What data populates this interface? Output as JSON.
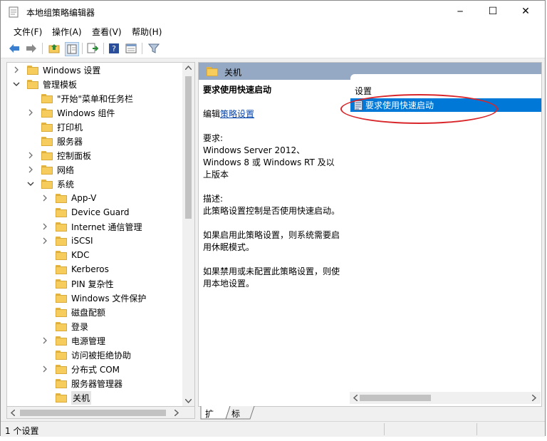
{
  "window": {
    "title": "本地组策略编辑器",
    "controls": {
      "minimize": "─",
      "maximize": "☐",
      "close": "✕"
    }
  },
  "menu": [
    "文件(F)",
    "操作(A)",
    "查看(V)",
    "帮助(H)"
  ],
  "toolbar": {
    "icons": [
      "back-arrow-icon",
      "forward-arrow-icon",
      "up-folder-icon",
      "show-hide-tree-icon",
      "export-list-icon",
      "help-icon",
      "properties-icon",
      "filter-icon"
    ]
  },
  "tree": {
    "items": [
      {
        "label": "Windows 设置",
        "expander": "collapsed"
      },
      {
        "label": "管理模板",
        "expander": "expanded"
      },
      {
        "label": "\"开始\"菜单和任务栏",
        "expander": "none"
      },
      {
        "label": "Windows 组件",
        "expander": "collapsed"
      },
      {
        "label": "打印机",
        "expander": "none"
      },
      {
        "label": "服务器",
        "expander": "none"
      },
      {
        "label": "控制面板",
        "expander": "collapsed"
      },
      {
        "label": "网络",
        "expander": "collapsed"
      },
      {
        "label": "系统",
        "expander": "expanded"
      },
      {
        "label": "App-V",
        "expander": "collapsed"
      },
      {
        "label": "Device Guard",
        "expander": "none"
      },
      {
        "label": "Internet 通信管理",
        "expander": "collapsed"
      },
      {
        "label": "iSCSI",
        "expander": "collapsed"
      },
      {
        "label": "KDC",
        "expander": "none"
      },
      {
        "label": "Kerberos",
        "expander": "none"
      },
      {
        "label": "PIN 复杂性",
        "expander": "none"
      },
      {
        "label": "Windows 文件保护",
        "expander": "none"
      },
      {
        "label": "磁盘配额",
        "expander": "none"
      },
      {
        "label": "登录",
        "expander": "none"
      },
      {
        "label": "电源管理",
        "expander": "collapsed"
      },
      {
        "label": "访问被拒绝协助",
        "expander": "none"
      },
      {
        "label": "分布式 COM",
        "expander": "collapsed"
      },
      {
        "label": "服务器管理器",
        "expander": "none"
      },
      {
        "label": "关机",
        "expander": "none",
        "selected": true
      }
    ]
  },
  "right": {
    "header": "关机",
    "desc_title": "要求使用快速启动",
    "edit_prefix": "编辑",
    "edit_link": "策略设置",
    "req_label": "要求:",
    "req_value": "Windows Server 2012、Windows 8 或 Windows RT 及以上版本",
    "desc_label": "描述:",
    "desc_value": "此策略设置控制是否使用快速启动。",
    "enabled_text": "如果启用此策略设置，则系统需要启用休眠模式。",
    "disabled_text": "如果禁用或未配置此策略设置，则使用本地设置。",
    "list_header": "设置",
    "list_item": "要求使用快速启动"
  },
  "tabs": [
    "扩展",
    "标准"
  ],
  "status": "1 个设置",
  "colors": {
    "selection": "#0078d7",
    "header": "#95a8c4",
    "annotation": "#d9262b"
  }
}
